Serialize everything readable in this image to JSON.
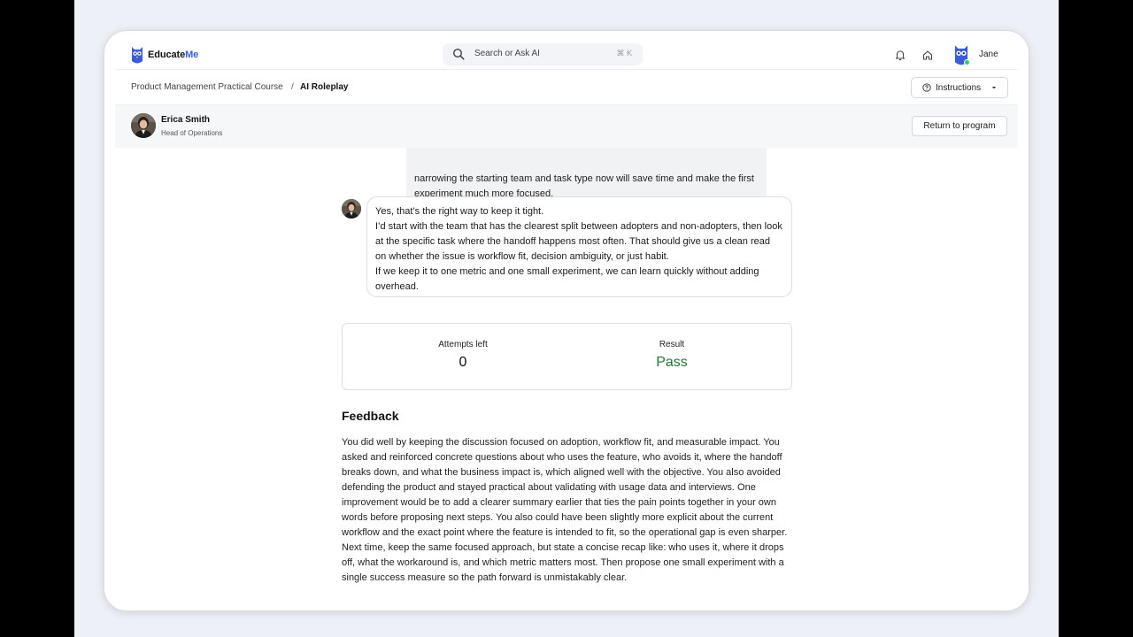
{
  "app": {
    "logo_text_main": "Educate",
    "logo_text_accent": "Me",
    "brand_color": "#3b5bdb"
  },
  "header": {
    "search_placeholder": "Search or Ask AI",
    "search_shortcut": "⌘ K",
    "icons": [
      "search-icon",
      "bell-icon",
      "home-icon",
      "owl-avatar-icon"
    ],
    "user_name": "Jane"
  },
  "breadcrumb": {
    "course": "Product Management Practical Course",
    "separator": "/",
    "current": "AI Roleplay"
  },
  "instructions_button": {
    "label": "Instructions"
  },
  "persona": {
    "name": "Erica Smith",
    "role": "Head of Operations",
    "return_label": "Return to program"
  },
  "chat": {
    "user_message_visible": "narrowing the starting team and task type now will save time and make the first experiment much more focused.",
    "ai_message": [
      "Yes, that’s the right way to keep it tight.",
      "I’d start with the team that has the clearest split between adopters and non-adopters, then look at the specific task where the handoff happens most often. That should give us a clean read on whether the issue is workflow fit, decision ambiguity, or just habit.",
      "If we keep it to one metric and one small experiment, we can learn quickly without adding overhead."
    ]
  },
  "result": {
    "attempts_label": "Attempts left",
    "attempts_value": "0",
    "result_label": "Result",
    "result_value": "Pass",
    "pass_color": "#1e7b34"
  },
  "feedback": {
    "title": "Feedback",
    "body": "You did well by keeping the discussion focused on adoption, workflow fit, and measurable impact. You asked and reinforced concrete questions about who uses the feature, who avoids it, where the handoff breaks down, and what the business impact is, which aligned well with the objective. You also avoided defending the product and stayed practical about validating with usage data and interviews. One improvement would be to add a clearer summary earlier that ties the pain points together in your own words before proposing next steps. You also could have been slightly more explicit about the current workflow and the exact point where the feature is intended to fit, so the operational gap is even sharper. Next time, keep the same focused approach, but state a concise recap like: who uses it, where it drops off, what the workaround is, and which metric matters most. Then propose one small experiment with a single success measure so the path forward is unmistakably clear."
  }
}
